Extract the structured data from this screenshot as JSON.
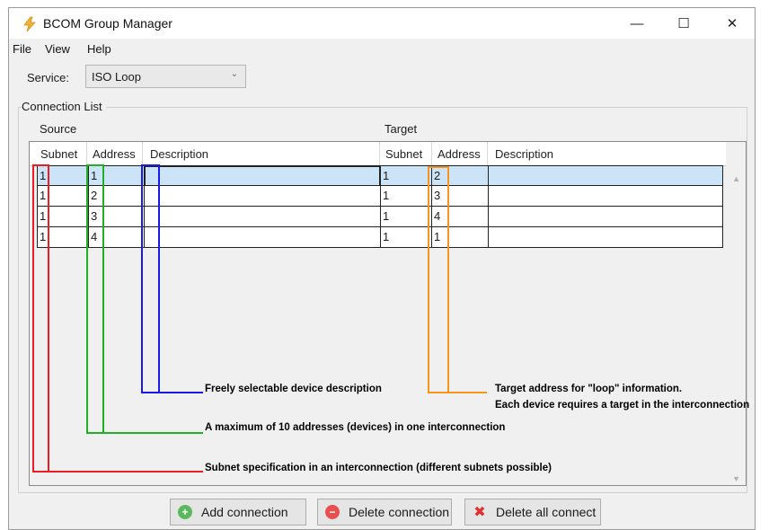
{
  "window": {
    "title": "BCOM Group Manager",
    "icon": "lightning-bolt-icon",
    "controls": {
      "minimize": "—",
      "maximize": "☐",
      "close": "✕"
    }
  },
  "menu": [
    "File",
    "View",
    "Help"
  ],
  "service": {
    "label": "Service:",
    "selected": "ISO Loop"
  },
  "connection_list": {
    "title": "Connection List",
    "source_label": "Source",
    "target_label": "Target",
    "columns": [
      "Subnet",
      "Address",
      "Description",
      "Subnet",
      "Address",
      "Description"
    ],
    "rows": [
      {
        "src_subnet": "1",
        "src_address": "1",
        "src_description": "",
        "tgt_subnet": "1",
        "tgt_address": "2",
        "tgt_description": ""
      },
      {
        "src_subnet": "1",
        "src_address": "2",
        "src_description": "",
        "tgt_subnet": "1",
        "tgt_address": "3",
        "tgt_description": ""
      },
      {
        "src_subnet": "1",
        "src_address": "3",
        "src_description": "",
        "tgt_subnet": "1",
        "tgt_address": "4",
        "tgt_description": ""
      },
      {
        "src_subnet": "1",
        "src_address": "4",
        "src_description": "",
        "tgt_subnet": "1",
        "tgt_address": "1",
        "tgt_description": ""
      }
    ]
  },
  "annotations": {
    "description": "Freely selectable device description",
    "target_line1": "Target address for \"loop\" information.",
    "target_line2": "Each device requires a target in the interconnection",
    "addresses": "A maximum of 10 addresses (devices) in one interconnection",
    "subnet": "Subnet specification in an interconnection (different subnets possible)"
  },
  "colors": {
    "subnet": "#ee1c25",
    "address": "#21b024",
    "description": "#1a1ae6",
    "target": "#f7941d",
    "selection": "#cce4f7"
  },
  "buttons": {
    "add": {
      "label": "Add connection",
      "icon": "plus-circle-icon",
      "color": "#5cb85c"
    },
    "delete": {
      "label": "Delete connection",
      "icon": "minus-circle-icon",
      "color": "#e85050"
    },
    "delete_all": {
      "label": "Delete all connect",
      "icon": "red-x-icon",
      "color": "#e03030"
    }
  }
}
